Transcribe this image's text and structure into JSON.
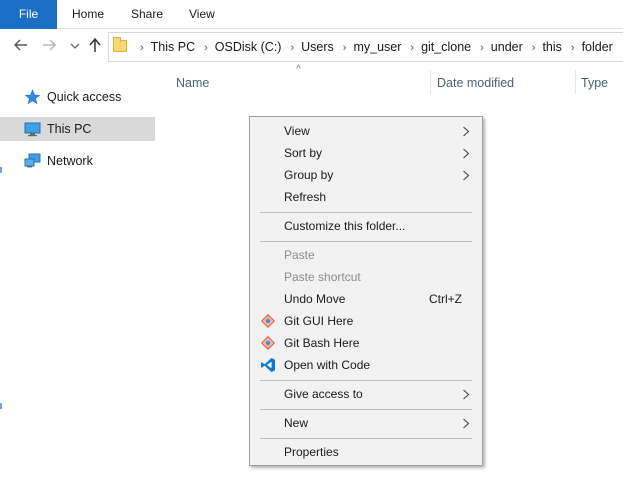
{
  "ribbon": {
    "tabs": [
      "File",
      "Home",
      "Share",
      "View"
    ]
  },
  "address_bar": {
    "crumbs": [
      "This PC",
      "OSDisk (C:)",
      "Users",
      "my_user",
      "git_clone",
      "under",
      "this",
      "folder"
    ]
  },
  "sidebar": {
    "items": [
      {
        "label": "Quick access",
        "icon": "star-icon"
      },
      {
        "label": "This PC",
        "icon": "computer-icon",
        "selected": true
      },
      {
        "label": "Network",
        "icon": "network-icon"
      }
    ]
  },
  "columns": {
    "name": "Name",
    "date_modified": "Date modified",
    "type": "Type"
  },
  "context_menu": {
    "view": "View",
    "sort_by": "Sort by",
    "group_by": "Group by",
    "refresh": "Refresh",
    "customize": "Customize this folder...",
    "paste": "Paste",
    "paste_shortcut": "Paste shortcut",
    "undo_move": "Undo Move",
    "undo_shortcut": "Ctrl+Z",
    "git_gui": "Git GUI Here",
    "git_bash": "Git Bash Here",
    "open_code": "Open with Code",
    "give_access": "Give access to",
    "new": "New",
    "properties": "Properties"
  },
  "colors": {
    "file_tab": "#1a6fc4",
    "selected_item": "#d9d9d9",
    "menu_bg": "#f2f2f2",
    "git_orange": "#f05133",
    "vscode_blue": "#0a78d4"
  }
}
